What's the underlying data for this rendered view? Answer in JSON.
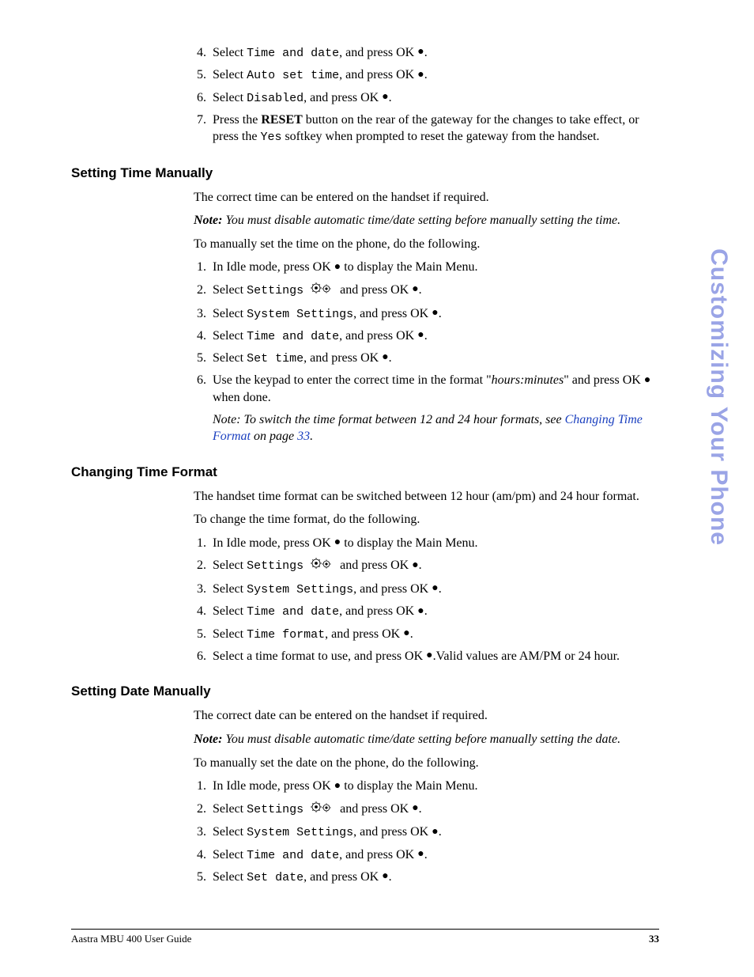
{
  "sideTitle": "Customizing Your Phone",
  "footer": {
    "guide": "Aastra MBU 400 User Guide",
    "page": "33"
  },
  "topList": {
    "start": 4,
    "items": [
      {
        "pre": "Select ",
        "mono": "Time and date",
        "post": ", and press OK "
      },
      {
        "pre": "Select ",
        "mono": "Auto set time",
        "post": ", and press OK "
      },
      {
        "pre": "Select ",
        "mono": "Disabled",
        "post": ", and press OK "
      },
      {
        "text1": "Press the ",
        "bold": "RESET",
        "text2": " button on the rear of the gateway for the changes to take effect, or press the ",
        "mono": "Yes",
        "text3": " softkey when prompted to reset the gateway from the handset."
      }
    ]
  },
  "sec1": {
    "heading": "Setting Time Manually",
    "p1": "The correct time can be entered on the handset if required.",
    "noteLabel": "Note:",
    "noteText": " You must disable automatic time/date setting before manually setting the time.",
    "p2": "To manually set the time on the phone, do the following.",
    "steps": [
      {
        "pre": "In Idle mode, press OK ",
        "post": " to display the Main Menu."
      },
      {
        "pre": "Select ",
        "mono": "Settings",
        "gears": true,
        "mid": " and press OK "
      },
      {
        "pre": "Select ",
        "mono": "System Settings",
        "post": ", and press OK "
      },
      {
        "pre": "Select ",
        "mono": "Time and date",
        "post": ", and press OK "
      },
      {
        "pre": "Select ",
        "mono": "Set time",
        "post": ", and press OK "
      },
      {
        "pre": "Use the keypad to enter the correct time in the format \"",
        "ital": "hours:minutes",
        "post2": "\" and press OK ",
        "post3": " when done."
      }
    ],
    "subNote": {
      "pre": "Note: To switch the time format between 12 and 24 hour formats, see ",
      "link": "Changing Time Format",
      "mid": " on page ",
      "pageLink": "33",
      "post": "."
    }
  },
  "sec2": {
    "heading": "Changing Time Format",
    "p1": "The handset time format can be switched between 12 hour (am/pm) and 24 hour format.",
    "p2": "To change the time format, do the following.",
    "steps": [
      {
        "pre": "In Idle mode, press OK ",
        "post": " to display the Main Menu."
      },
      {
        "pre": "Select ",
        "mono": "Settings",
        "gears": true,
        "mid": " and press OK "
      },
      {
        "pre": "Select ",
        "mono": "System Settings",
        "post": ", and press OK "
      },
      {
        "pre": "Select ",
        "mono": "Time and date",
        "post": ", and press OK "
      },
      {
        "pre": "Select ",
        "mono": "Time format",
        "post": ", and press OK "
      },
      {
        "pre": "Select a time format to use, and press OK ",
        "post4": ".Valid values are AM/PM or 24 hour."
      }
    ]
  },
  "sec3": {
    "heading": "Setting Date Manually",
    "p1": "The correct date can be entered on the handset if required.",
    "noteLabel": "Note:",
    "noteText": " You must disable automatic time/date setting before manually setting the date.",
    "p2": "To manually set the date on the phone, do the following.",
    "steps": [
      {
        "pre": "In Idle mode, press OK ",
        "post": " to display the Main Menu."
      },
      {
        "pre": "Select ",
        "mono": "Settings",
        "gears": true,
        "mid": " and press OK "
      },
      {
        "pre": "Select ",
        "mono": "System Settings",
        "post": ", and press OK "
      },
      {
        "pre": "Select ",
        "mono": "Time and date",
        "post": ", and press OK "
      },
      {
        "pre": "Select ",
        "mono": "Set date",
        "post": ", and press OK "
      }
    ]
  }
}
